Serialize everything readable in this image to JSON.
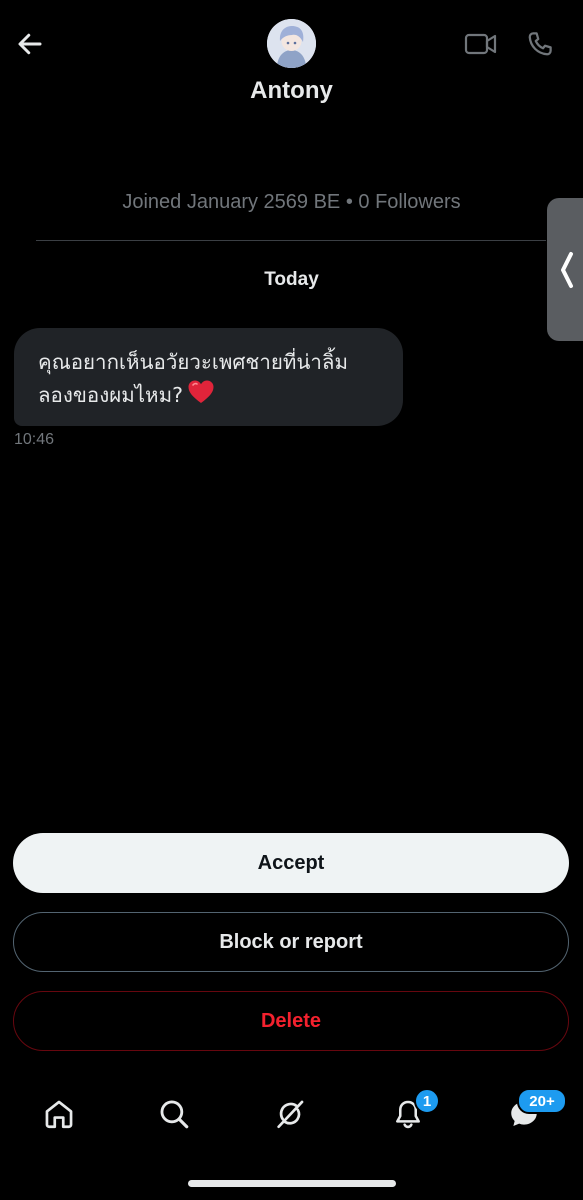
{
  "header": {
    "name": "Antony",
    "icons": {
      "back": "arrow-left-icon",
      "video": "video-camera-icon",
      "phone": "phone-icon",
      "avatar": "avatar"
    }
  },
  "profile": {
    "joined": "Joined January 2569 BE • 0 Followers"
  },
  "conversation": {
    "day_label": "Today",
    "messages": [
      {
        "lines": [
          "คุณอยากเห็นอวัยวะเพศชายที่น่าลิ้ม",
          "ลองของผมไหม?"
        ],
        "emoji": "red-heart-icon",
        "time": "10:46"
      }
    ]
  },
  "actions": {
    "accept": "Accept",
    "block": "Block or report",
    "delete": "Delete"
  },
  "nav": {
    "items": [
      "home-icon",
      "search-icon",
      "grok-icon",
      "notifications-icon",
      "messages-icon"
    ],
    "notifications_badge": "1",
    "messages_badge": "20+"
  },
  "colors": {
    "background": "#000000",
    "bubble": "#202327",
    "muted": "#71767b",
    "danger": "#f4212e",
    "accent": "#1d9bf0"
  }
}
